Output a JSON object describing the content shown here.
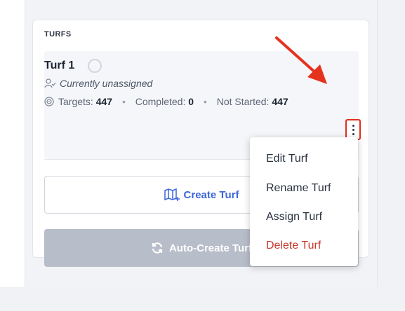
{
  "section": {
    "label": "TURFS"
  },
  "turf": {
    "name": "Turf 1",
    "assignment": "Currently unassigned",
    "targets_label": "Targets:",
    "targets_value": "447",
    "completed_label": "Completed:",
    "completed_value": "0",
    "not_started_label": "Not Started:",
    "not_started_value": "447",
    "separator": "•"
  },
  "buttons": {
    "create": "Create Turf",
    "auto_create": "Auto-Create Turf"
  },
  "menu": {
    "items": [
      {
        "label": "Edit Turf"
      },
      {
        "label": "Rename Turf"
      },
      {
        "label": "Assign Turf"
      },
      {
        "label": "Delete Turf"
      }
    ]
  },
  "colors": {
    "accent": "#3b66d9",
    "danger": "#c8372d",
    "highlight": "#e0301e",
    "disabled_button": "#b8bdca"
  },
  "icons": [
    "assign-user-icon",
    "target-icon",
    "kebab-menu-icon",
    "map-icon",
    "refresh-icon",
    "status-circle-icon"
  ]
}
